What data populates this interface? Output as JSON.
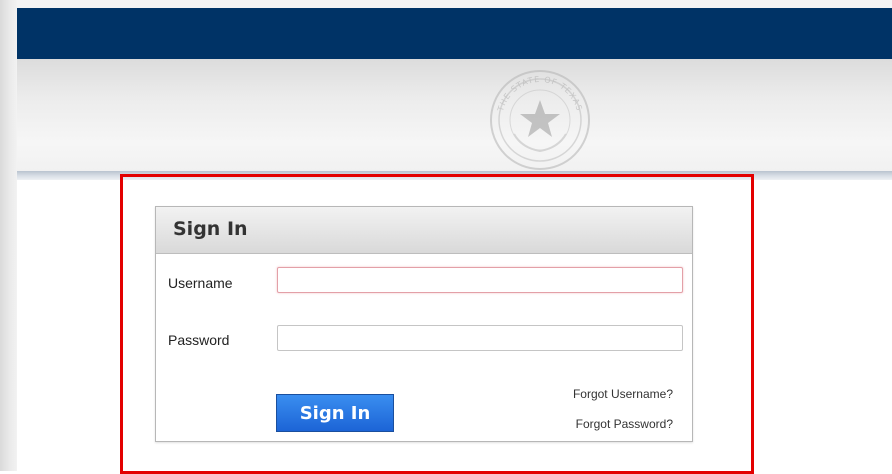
{
  "header": {
    "seal_text": "THE STATE OF TEXAS"
  },
  "signin": {
    "title": "Sign In",
    "username_label": "Username",
    "username_value": "",
    "password_label": "Password",
    "password_value": "",
    "button_label": "Sign In",
    "forgot_username": "Forgot Username?",
    "forgot_password": "Forgot Password?"
  },
  "colors": {
    "header_bar": "#003366",
    "button": "#1c64d6",
    "highlight_border": "#e30000"
  },
  "icons": {
    "seal": "state-seal-icon"
  }
}
